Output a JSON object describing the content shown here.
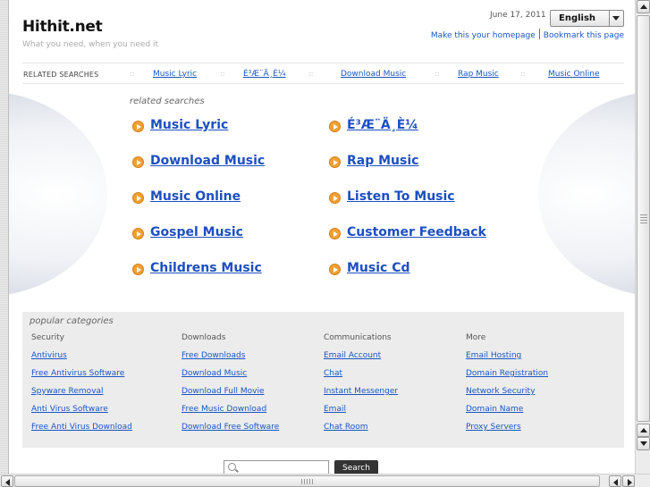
{
  "site": {
    "title": "Hithit.net",
    "tagline": "What you need, when you need it"
  },
  "header": {
    "date": "June 17, 2011",
    "language": "English",
    "make_homepage": "Make this your homepage",
    "bookmark": "Bookmark this page"
  },
  "related_bar": {
    "label": "RELATED SEARCHES",
    "separator": "::",
    "links": [
      "Music Lyric",
      "É³Æ¨Ä¸È¼",
      "Download Music",
      "Rap Music",
      "Music Online"
    ]
  },
  "related": {
    "heading": "related searches",
    "items": [
      "Music Lyric",
      "É³Æ¨Ä¸È¼",
      "Download Music",
      "Rap Music",
      "Music Online",
      "Listen To Music",
      "Gospel Music",
      "Customer Feedback",
      "Childrens Music",
      "Music Cd"
    ]
  },
  "popular": {
    "heading": "popular categories",
    "columns": [
      {
        "title": "Security",
        "links": [
          "Antivirus",
          "Free Antivirus Software",
          "Spyware Removal",
          "Anti Virus Software",
          "Free Anti Virus Download"
        ]
      },
      {
        "title": "Downloads",
        "links": [
          "Free Downloads",
          "Download Music",
          "Download Full Movie",
          "Free Music Download",
          "Download Free Software"
        ]
      },
      {
        "title": "Communications",
        "links": [
          "Email Account",
          "Chat",
          "Instant Messenger",
          "Email",
          "Chat Room"
        ]
      },
      {
        "title": "More",
        "links": [
          "Email Hosting",
          "Domain Registration",
          "Network Security",
          "Domain Name",
          "Proxy Servers"
        ]
      }
    ]
  },
  "search": {
    "value": "",
    "button_label": "Search"
  },
  "colors": {
    "link": "#1a55c4",
    "arrow": "#f3a032",
    "panel": "#ececec"
  }
}
